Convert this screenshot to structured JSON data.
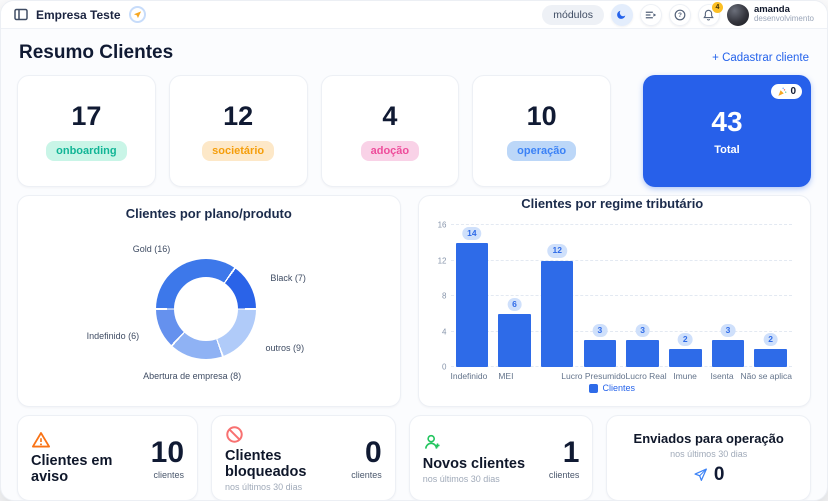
{
  "header": {
    "app_title": "Empresa Teste",
    "modules_button": "módulos",
    "notification_badge": "4",
    "user": {
      "name": "amanda",
      "role": "desenvolvimento"
    }
  },
  "page": {
    "title": "Resumo Clientes",
    "add_client_link": "+ Cadastrar cliente"
  },
  "stats": {
    "cards": [
      {
        "value": "17",
        "label": "onboarding",
        "badge_bg": "#c9f5e7",
        "badge_color": "#12b596"
      },
      {
        "value": "12",
        "label": "societário",
        "badge_bg": "#fde8c8",
        "badge_color": "#f59e0b"
      },
      {
        "value": "4",
        "label": "adoção",
        "badge_bg": "#f9d2e7",
        "badge_color": "#ee4d9b"
      },
      {
        "value": "10",
        "label": "operação",
        "badge_bg": "#bcd7f8",
        "badge_color": "#3b82f6"
      }
    ],
    "total": {
      "value": "43",
      "label": "Total",
      "pill_icon": "party-popper-icon",
      "pill_value": "0",
      "bg": "#2760ea"
    }
  },
  "chart_data": [
    {
      "type": "pie",
      "donut": true,
      "title": "Clientes por plano/produto",
      "labels": [
        "Gold (16)",
        "Black (7)",
        "outros (9)",
        "Abertura de empresa (8)",
        "Indefinido (6)"
      ],
      "values": [
        16,
        7,
        9,
        8,
        6
      ],
      "colors": [
        "#3d78ea",
        "#2a63e8",
        "#b0cbf9",
        "#8fb2f4",
        "#6591ee"
      ],
      "rotation_deg": 270,
      "legend_position": "none"
    },
    {
      "type": "bar",
      "title": "Clientes por regime tributário",
      "categories": [
        "Indefinido",
        "MEI",
        "",
        "Lucro Presumido",
        "Lucro Real",
        "Imune",
        "Isenta",
        "Não se aplica"
      ],
      "values": [
        14,
        6,
        12,
        3,
        3,
        2,
        3,
        2
      ],
      "ylim": [
        0,
        16
      ],
      "yticks": [
        0,
        4,
        8,
        12,
        16
      ],
      "grid": "dashed",
      "legend": "Clientes",
      "bar_color": "#2e6be8",
      "value_pill_bg": "#cfe0fb",
      "value_pill_color": "#2f6be8"
    }
  ],
  "bottom": {
    "cards": [
      {
        "icon": "warning-icon",
        "title": "Clientes em aviso",
        "subtitle": "",
        "value": "10",
        "unit": "clientes"
      },
      {
        "icon": "block-icon",
        "title": "Clientes bloqueados",
        "subtitle": "nos últimos 30 dias",
        "value": "0",
        "unit": "clientes"
      },
      {
        "icon": "user-plus-icon",
        "title": "Novos clientes",
        "subtitle": "nos últimos 30 dias",
        "value": "1",
        "unit": "clientes"
      }
    ],
    "sent_card": {
      "icon": "paper-plane-icon",
      "title": "Enviados para operação",
      "subtitle": "nos últimos 30 dias",
      "value": "0"
    }
  }
}
